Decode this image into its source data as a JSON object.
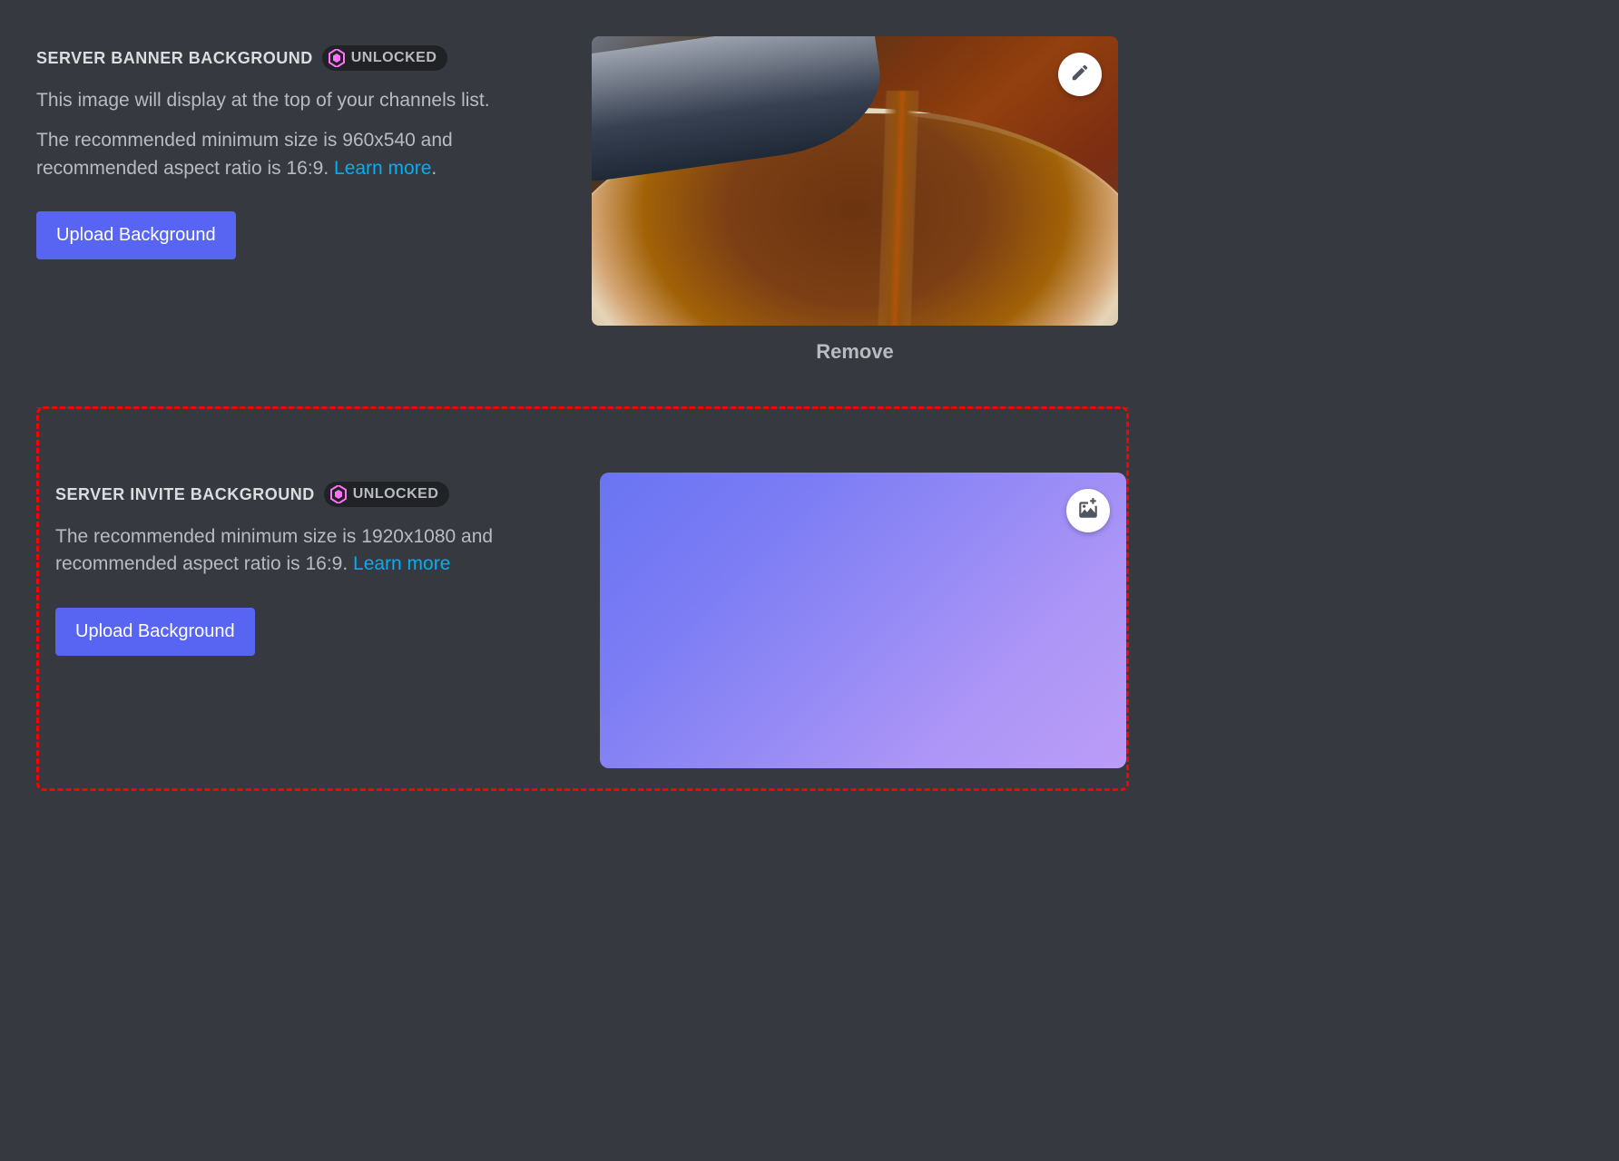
{
  "banner": {
    "heading": "SERVER BANNER BACKGROUND",
    "unlocked_label": "UNLOCKED",
    "description1": "This image will display at the top of your channels list.",
    "description2_pre": "The recommended minimum size is 960x540 and recommended aspect ratio is 16:9. ",
    "learn_more": "Learn more",
    "description2_post": ".",
    "upload_button": "Upload Background",
    "remove_label": "Remove"
  },
  "invite": {
    "heading": "SERVER INVITE BACKGROUND",
    "unlocked_label": "UNLOCKED",
    "description_pre": "The recommended minimum size is 1920x1080 and recommended aspect ratio is 16:9. ",
    "learn_more": "Learn more",
    "upload_button": "Upload Background"
  },
  "colors": {
    "accent": "#5865f2",
    "link": "#00aff4",
    "highlight": "#ff0000"
  }
}
